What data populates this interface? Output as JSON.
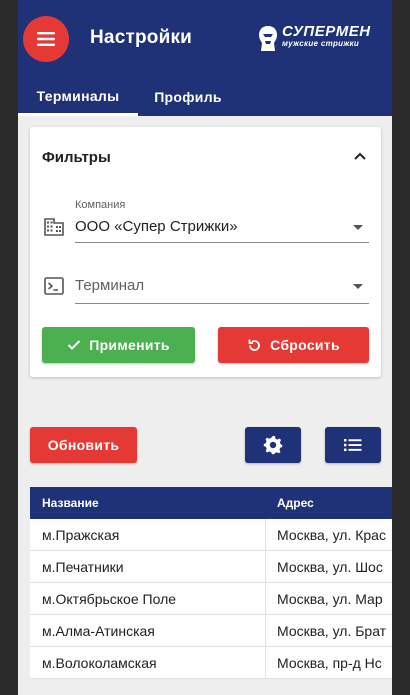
{
  "header": {
    "title": "Настройки",
    "logo_main": "СУПЕРМЕН",
    "logo_sub": "мужские стрижки",
    "brand_color": "#1f3177",
    "accent_color": "#e53935"
  },
  "tabs": [
    {
      "label": "Терминалы",
      "active": true
    },
    {
      "label": "Профиль",
      "active": false
    }
  ],
  "filters": {
    "title": "Фильтры",
    "company": {
      "label": "Компания",
      "value": "ООО «Супер Стрижки»"
    },
    "terminal": {
      "placeholder": "Терминал",
      "value": ""
    },
    "apply_label": "Применить",
    "reset_label": "Сбросить"
  },
  "toolbar": {
    "refresh_label": "Обновить"
  },
  "table": {
    "columns": [
      "Название",
      "Адрес"
    ],
    "rows": [
      [
        "м.Пражская",
        "Москва, ул. Крас"
      ],
      [
        "м.Печатники",
        "Москва, ул. Шос"
      ],
      [
        "м.Октябрьское Поле",
        "Москва, ул. Мар"
      ],
      [
        "м.Алма-Атинская",
        "Москва, ул. Брат"
      ],
      [
        "м.Волоколамская",
        "Москва, пр-д Нс"
      ]
    ]
  }
}
